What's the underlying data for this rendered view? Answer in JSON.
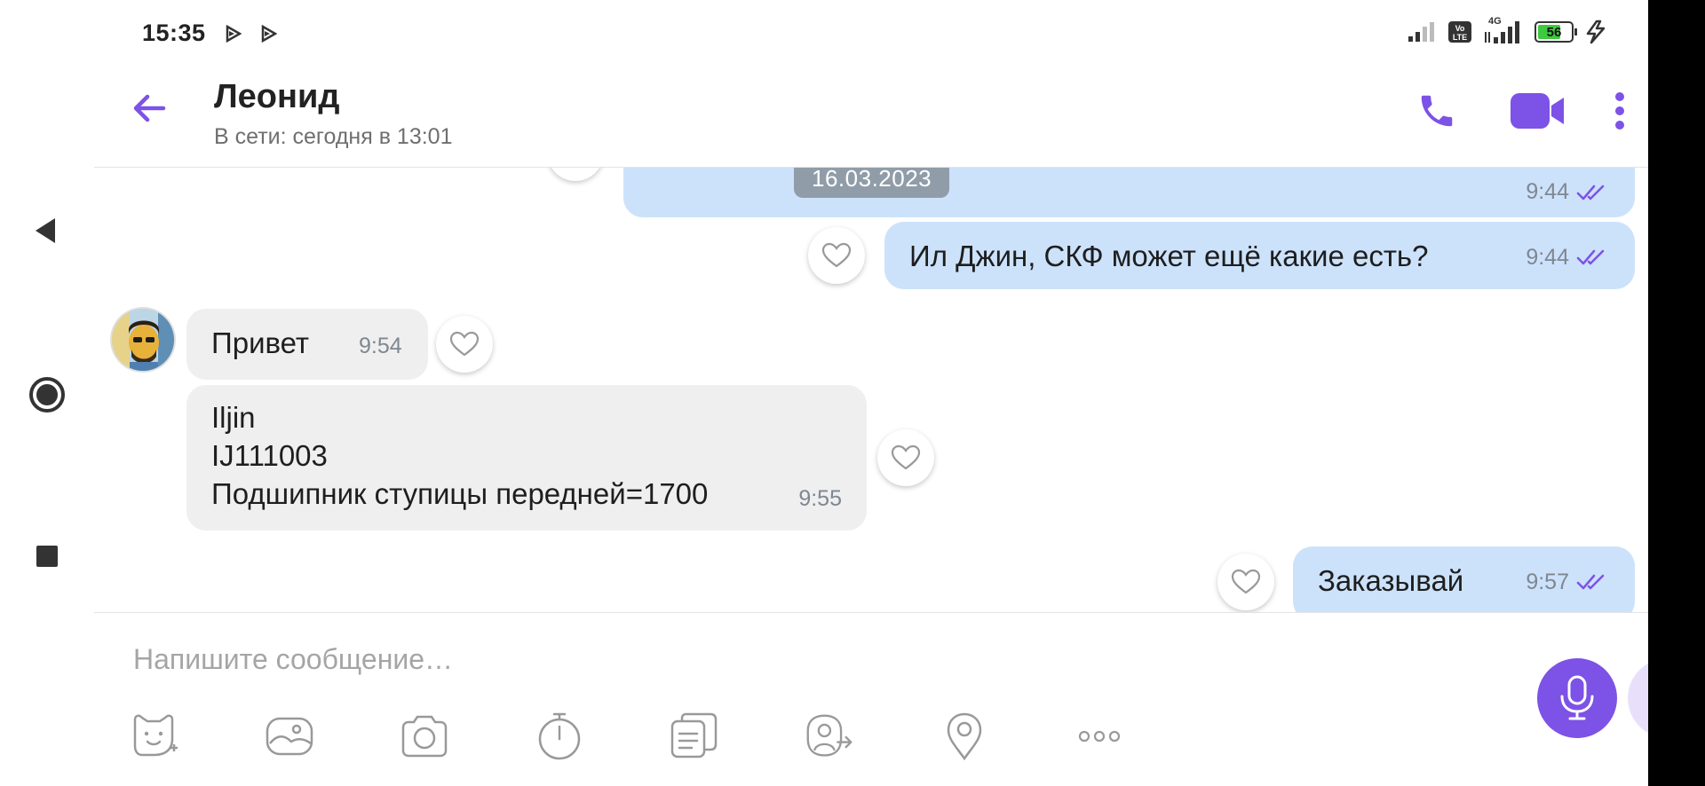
{
  "status_bar": {
    "time": "15:35",
    "battery": "56",
    "network": "4G"
  },
  "header": {
    "contact_name": "Леонид",
    "presence": "В сети: сегодня в 13:01"
  },
  "date_separator": "16.03.2023",
  "messages": [
    {
      "direction": "out",
      "text": "",
      "time": "9:44",
      "read": true
    },
    {
      "direction": "out",
      "text": "Ил Джин, СКФ может ещё какие есть?",
      "time": "9:44",
      "read": true
    },
    {
      "direction": "in",
      "text": "Привет",
      "time": "9:54"
    },
    {
      "direction": "in",
      "lines": [
        "Iljin",
        "IJ111003",
        "Подшипник ступицы передней=1700"
      ],
      "time": "9:55"
    },
    {
      "direction": "out",
      "text": "Заказывай",
      "time": "9:57",
      "read": true
    }
  ],
  "composer": {
    "placeholder": "Напишите сообщение…"
  },
  "colors": {
    "accent": "#7d52e6",
    "outgoing_bubble": "#cce2fb",
    "incoming_bubble": "#efefef",
    "date_chip": "#909da9"
  },
  "icons": {
    "back": "arrow-left-icon",
    "call": "phone-icon",
    "video": "video-camera-icon",
    "more": "more-vertical-icon",
    "like": "heart-icon",
    "read": "double-check-icon",
    "mic": "microphone-icon",
    "toolbar": [
      "sticker-icon",
      "gallery-icon",
      "camera-icon",
      "timer-icon",
      "notes-icon",
      "share-contact-icon",
      "location-icon",
      "more-horizontal-icon"
    ]
  }
}
